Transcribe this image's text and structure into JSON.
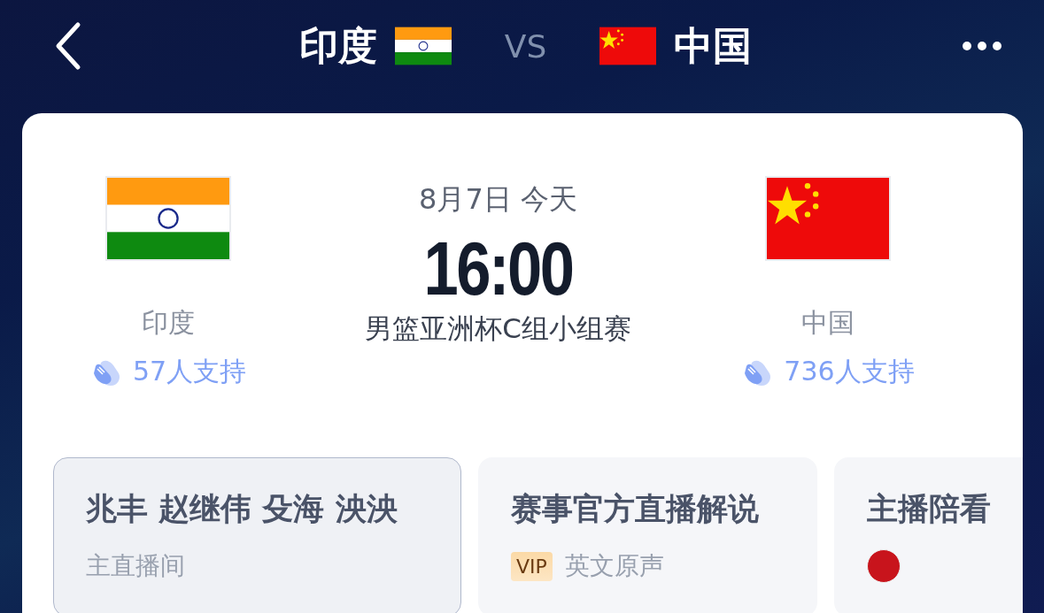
{
  "header": {
    "home": "印度",
    "vs": "VS",
    "away": "中国"
  },
  "match": {
    "home": {
      "name": "印度",
      "support": "57人支持"
    },
    "away": {
      "name": "中国",
      "support": "736人支持"
    },
    "date": "8月7日 今天",
    "time": "16:00",
    "league": "男篮亚洲杯C组小组赛"
  },
  "channels": [
    {
      "kind": "text",
      "title": "兆丰 赵继伟 殳海 泱泱",
      "subtitle": "主直播间",
      "selected": true
    },
    {
      "kind": "vip",
      "title": "赛事官方直播解说",
      "badge": "VIP",
      "subtitle": "英文原声",
      "selected": false
    },
    {
      "kind": "avatar",
      "title": "主播陪看",
      "selected": false
    }
  ]
}
